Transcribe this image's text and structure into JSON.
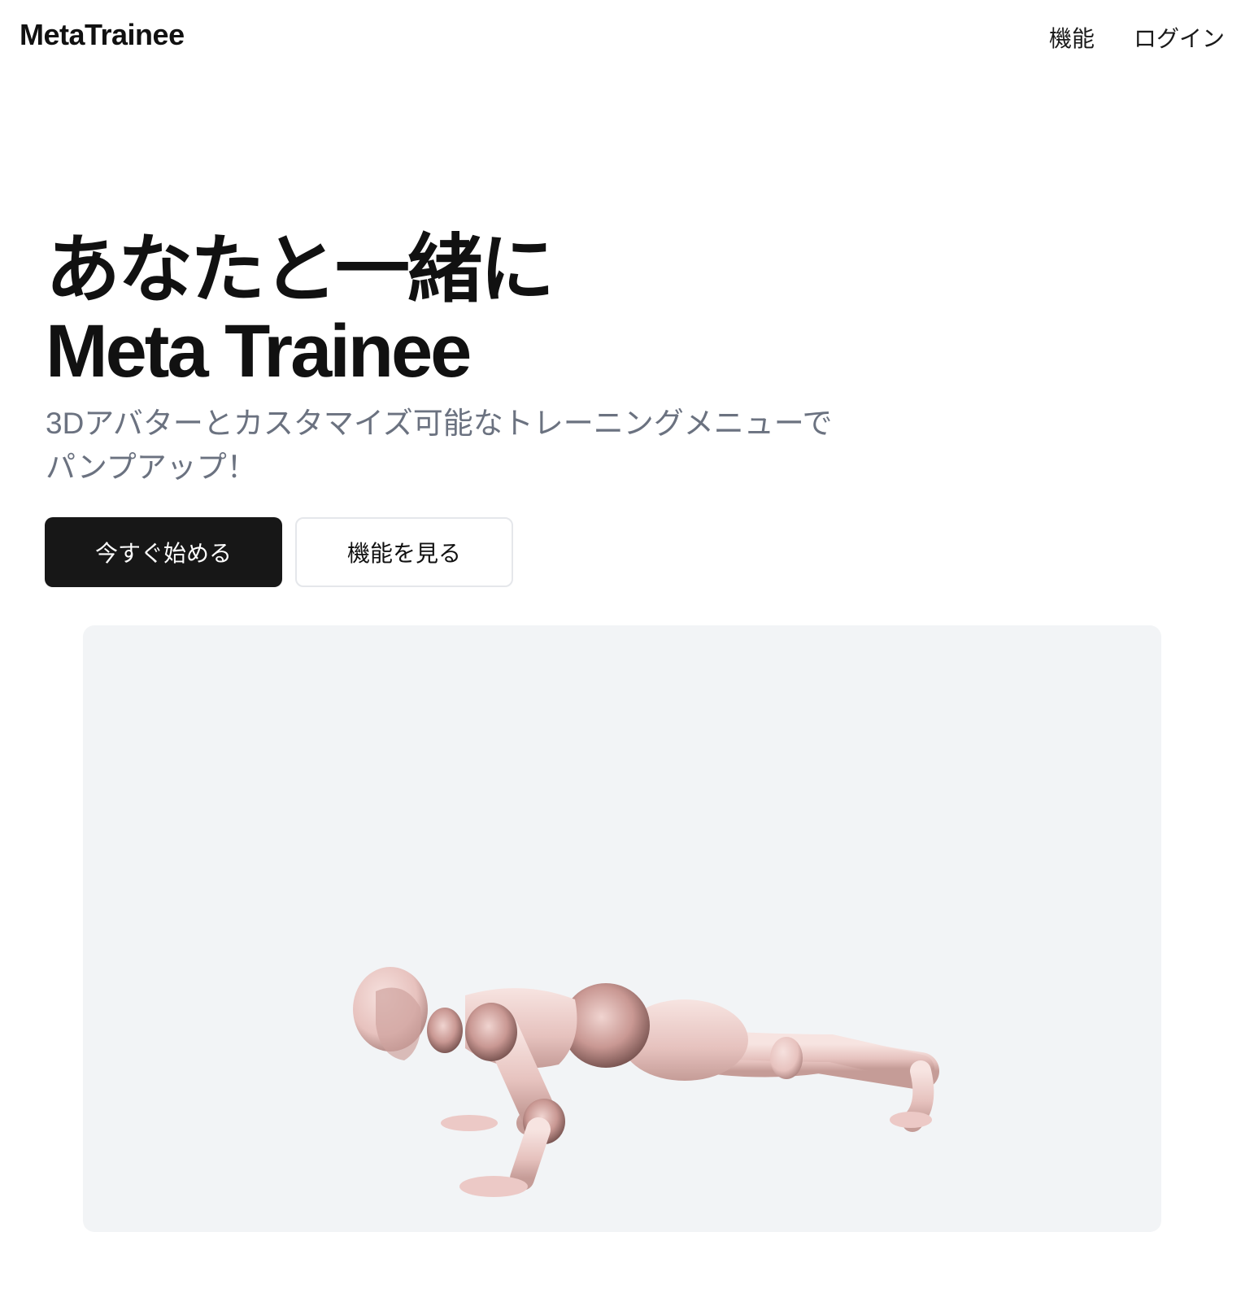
{
  "header": {
    "logo": "MetaTrainee",
    "nav": [
      {
        "label": "機能"
      },
      {
        "label": "ログイン"
      }
    ]
  },
  "hero": {
    "title_line1": "あなたと一緒に",
    "title_line2": "Meta Trainee",
    "subtitle_line1": "3Dアバターとカスタマイズ可能なトレーニングメニューで",
    "subtitle_line2": "パンプアップ！",
    "primary_button": "今すぐ始める",
    "secondary_button": "機能を見る"
  },
  "viewer": {
    "avatar": "pushup-mannequin",
    "background_color": "#f2f4f6",
    "avatar_color": "#ecc9c6"
  }
}
